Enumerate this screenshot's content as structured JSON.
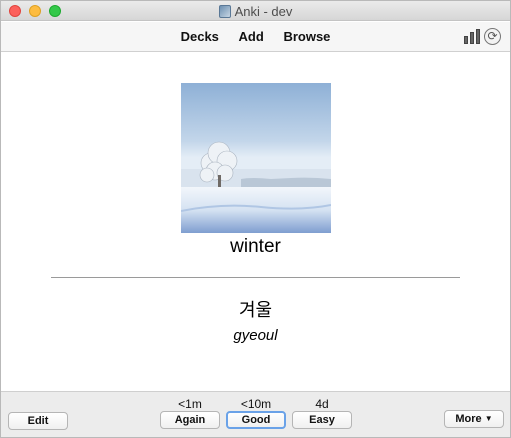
{
  "window": {
    "title": "Anki - dev"
  },
  "toolbar": {
    "decks": "Decks",
    "add": "Add",
    "browse": "Browse"
  },
  "card": {
    "front": "winter",
    "back": "겨울",
    "romanization": "gyeoul",
    "image": {
      "alt": "snowy field with frosted tree"
    }
  },
  "reviewer": {
    "edit": "Edit",
    "more": "More",
    "answers": [
      {
        "interval": "<1m",
        "label": "Again"
      },
      {
        "interval": "<10m",
        "label": "Good"
      },
      {
        "interval": "4d",
        "label": "Easy"
      }
    ]
  },
  "icons": {
    "stats": "bar-chart-icon",
    "sync": "sync-icon",
    "app": "anki-app-icon",
    "more_chevron": "chevron-down-icon"
  },
  "colors": {
    "focus_ring": "#6aa2e8",
    "close": "#fc605c",
    "minimize": "#fdbc40",
    "zoom": "#34c84a"
  }
}
